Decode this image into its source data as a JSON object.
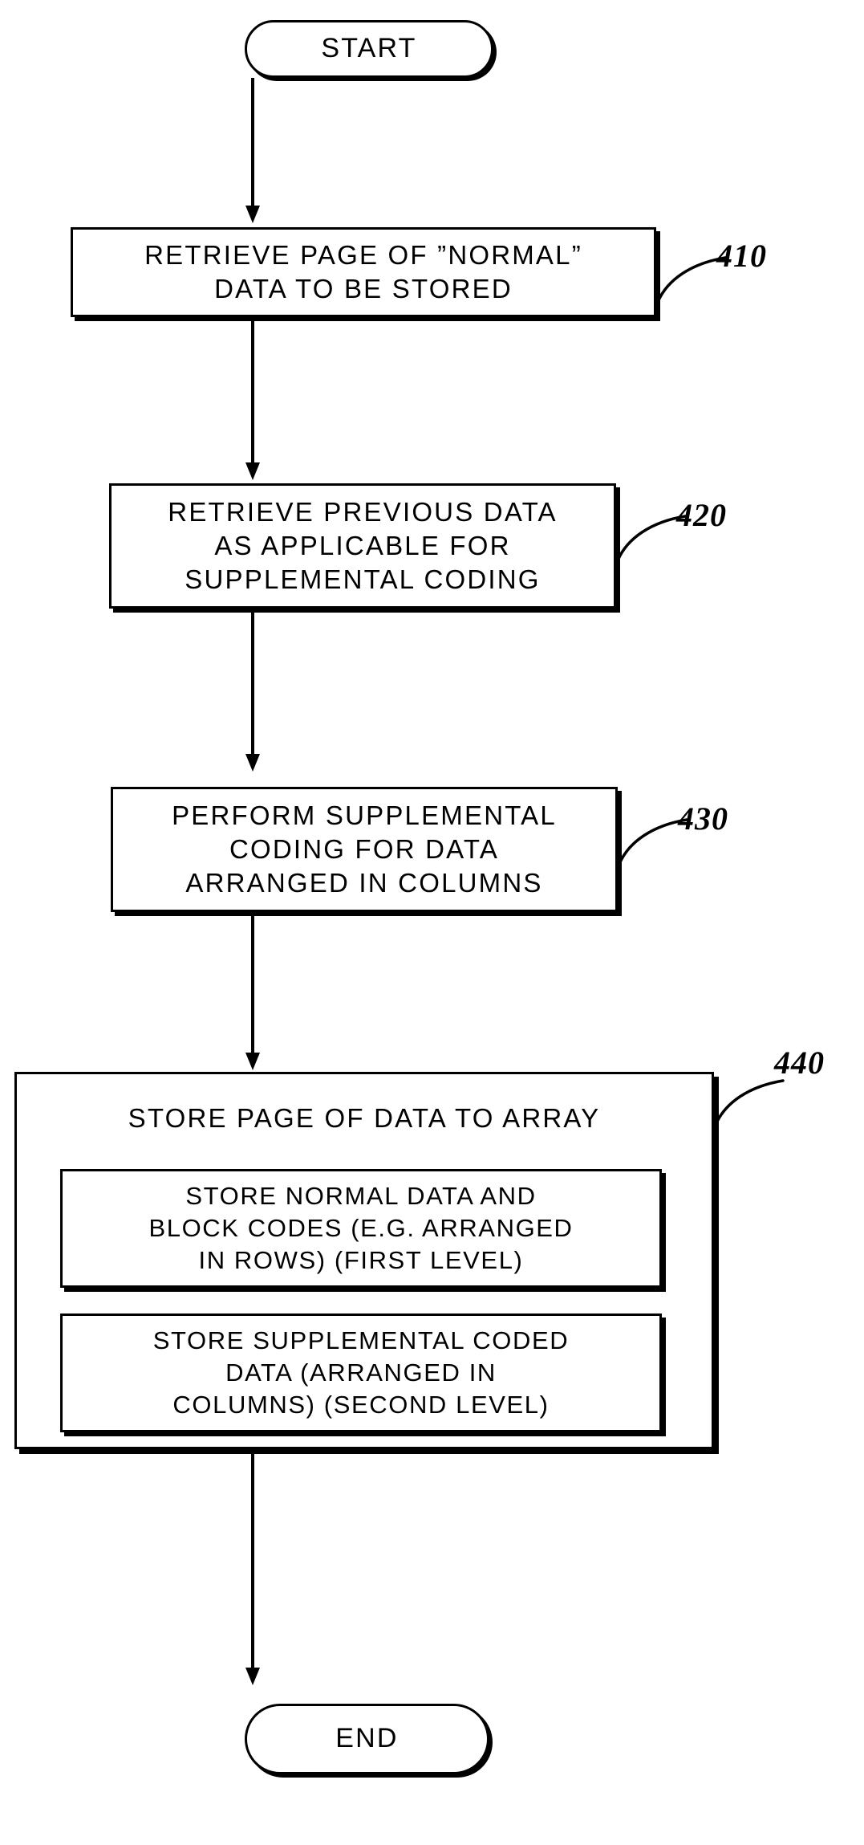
{
  "figure": {
    "type": "flowchart",
    "orientation": "vertical",
    "line_color": "#000000",
    "background_color": "#ffffff"
  },
  "nodes": {
    "start": {
      "label": "START",
      "shape": "terminator"
    },
    "step410": {
      "ref": "410",
      "shape": "process",
      "lines": [
        "RETRIEVE PAGE OF ”NORMAL”",
        "DATA TO BE STORED"
      ],
      "text": "RETRIEVE PAGE OF ”NORMAL” DATA TO BE STORED"
    },
    "step420": {
      "ref": "420",
      "shape": "process",
      "lines": [
        "RETRIEVE PREVIOUS DATA",
        "AS APPLICABLE FOR",
        "SUPPLEMENTAL CODING"
      ],
      "text": "RETRIEVE PREVIOUS DATA AS APPLICABLE FOR SUPPLEMENTAL CODING"
    },
    "step430": {
      "ref": "430",
      "shape": "process",
      "lines": [
        "PERFORM SUPPLEMENTAL",
        "CODING FOR DATA",
        "ARRANGED IN COLUMNS"
      ],
      "text": "PERFORM SUPPLEMENTAL CODING FOR DATA ARRANGED IN COLUMNS"
    },
    "step440": {
      "ref": "440",
      "shape": "process-group",
      "title": "STORE PAGE OF DATA TO ARRAY",
      "substeps": [
        {
          "lines": [
            "STORE NORMAL DATA AND",
            "BLOCK CODES (E.G. ARRANGED",
            "IN ROWS) (FIRST LEVEL)"
          ],
          "text": "STORE NORMAL DATA AND BLOCK CODES (E.G. ARRANGED IN ROWS) (FIRST LEVEL)"
        },
        {
          "lines": [
            "STORE SUPPLEMENTAL CODED",
            "DATA (ARRANGED IN",
            "COLUMNS) (SECOND LEVEL)"
          ],
          "text": "STORE SUPPLEMENTAL CODED DATA (ARRANGED IN COLUMNS) (SECOND LEVEL)"
        }
      ]
    },
    "end": {
      "label": "END",
      "shape": "terminator"
    }
  },
  "connectors": [
    {
      "from": "start",
      "to": "step410"
    },
    {
      "from": "step410",
      "to": "step420"
    },
    {
      "from": "step420",
      "to": "step430"
    },
    {
      "from": "step430",
      "to": "step440"
    },
    {
      "from": "step440",
      "to": "end"
    }
  ]
}
